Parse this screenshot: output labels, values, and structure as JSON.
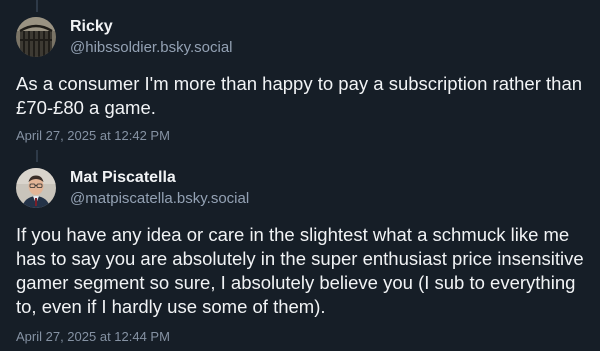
{
  "posts": [
    {
      "display_name": "Ricky",
      "handle": "@hibssoldier.bsky.social",
      "text": "As a consumer I'm more than happy to pay a subscription rather than £70-£80 a game.",
      "timestamp": "April 27, 2025 at 12:42 PM",
      "avatar_icon": "avatar-photo-gate"
    },
    {
      "display_name": "Mat Piscatella",
      "handle": "@matpiscatella.bsky.social",
      "text": "If you have any idea or care in the slightest what a schmuck like me has to say you are absolutely in the super enthusiast price insensitive gamer segment so sure, I absolutely believe you (I sub to everything to, even if I hardly use some of them).",
      "timestamp": "April 27, 2025 at 12:44 PM",
      "avatar_icon": "avatar-photo-man"
    }
  ],
  "colors": {
    "background": "#161e27",
    "primary_text": "#f1f3f5",
    "secondary_text": "#93a1b3",
    "thread_line": "#2e3a48"
  }
}
